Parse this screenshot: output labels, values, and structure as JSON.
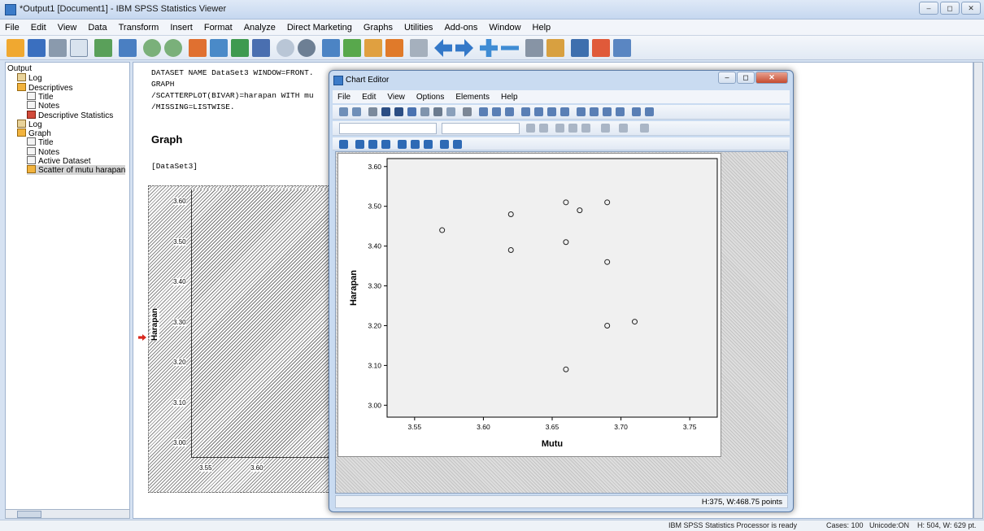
{
  "window": {
    "title": "*Output1 [Document1] - IBM SPSS Statistics Viewer"
  },
  "menubar": [
    "File",
    "Edit",
    "View",
    "Data",
    "Transform",
    "Insert",
    "Format",
    "Analyze",
    "Direct Marketing",
    "Graphs",
    "Utilities",
    "Add-ons",
    "Window",
    "Help"
  ],
  "nav": {
    "items": [
      {
        "label": "Output",
        "depth": 0,
        "icon": "output-icon"
      },
      {
        "label": "Log",
        "depth": 1,
        "icon": "log-book-icon"
      },
      {
        "label": "Descriptives",
        "depth": 1,
        "icon": "procedure-icon"
      },
      {
        "label": "Title",
        "depth": 2,
        "icon": "title-page-icon"
      },
      {
        "label": "Notes",
        "depth": 2,
        "icon": "notes-icon"
      },
      {
        "label": "Descriptive Statistics",
        "depth": 2,
        "icon": "table-icon"
      },
      {
        "label": "Log",
        "depth": 1,
        "icon": "log-book-icon"
      },
      {
        "label": "Graph",
        "depth": 1,
        "icon": "procedure-icon"
      },
      {
        "label": "Title",
        "depth": 2,
        "icon": "title-page-icon"
      },
      {
        "label": "Notes",
        "depth": 2,
        "icon": "notes-icon"
      },
      {
        "label": "Active Dataset",
        "depth": 2,
        "icon": "dataset-icon"
      },
      {
        "label": "Scatter of mutu harapan",
        "depth": 2,
        "icon": "chart-icon",
        "selected": true
      }
    ]
  },
  "content": {
    "syntax": [
      "DATASET NAME DataSet3 WINDOW=FRONT.",
      "GRAPH",
      "  /SCATTERPLOT(BIVAR)=harapan WITH mu",
      "  /MISSING=LISTWISE."
    ],
    "graph_heading": "Graph",
    "dataset_label": "[DataSet3]",
    "bg_chart": {
      "ylabel": "Harapan",
      "yticks": [
        "3.60",
        "3.50",
        "3.40",
        "3.30",
        "3.20",
        "3.10",
        "3.00"
      ],
      "xticks": [
        "3.55",
        "3.60"
      ]
    }
  },
  "chart_editor": {
    "title": "Chart Editor",
    "menu": [
      "File",
      "Edit",
      "View",
      "Options",
      "Elements",
      "Help"
    ],
    "status": "H:375, W:468.75 points"
  },
  "chart_data": {
    "type": "scatter",
    "xlabel": "Mutu",
    "ylabel": "Harapan",
    "xlim": [
      3.53,
      3.77
    ],
    "ylim": [
      2.97,
      3.62
    ],
    "xticks": [
      3.55,
      3.6,
      3.65,
      3.7,
      3.75
    ],
    "yticks": [
      3.0,
      3.1,
      3.2,
      3.3,
      3.4,
      3.5,
      3.6
    ],
    "xticklabels": [
      "3.55",
      "3.60",
      "3.65",
      "3.70",
      "3.75"
    ],
    "yticklabels": [
      "3.00",
      "3.10",
      "3.20",
      "3.30",
      "3.40",
      "3.50",
      "3.60"
    ],
    "points": [
      {
        "x": 3.57,
        "y": 3.44
      },
      {
        "x": 3.62,
        "y": 3.48
      },
      {
        "x": 3.62,
        "y": 3.39
      },
      {
        "x": 3.66,
        "y": 3.51
      },
      {
        "x": 3.67,
        "y": 3.49
      },
      {
        "x": 3.69,
        "y": 3.51
      },
      {
        "x": 3.66,
        "y": 3.41
      },
      {
        "x": 3.69,
        "y": 3.36
      },
      {
        "x": 3.69,
        "y": 3.2
      },
      {
        "x": 3.71,
        "y": 3.21
      },
      {
        "x": 3.66,
        "y": 3.09
      }
    ]
  },
  "statusbar": {
    "processor": "IBM SPSS Statistics Processor is ready",
    "cases": "Cases: 100",
    "unicode": "Unicode:ON",
    "size": "H: 504, W: 629 pt."
  }
}
